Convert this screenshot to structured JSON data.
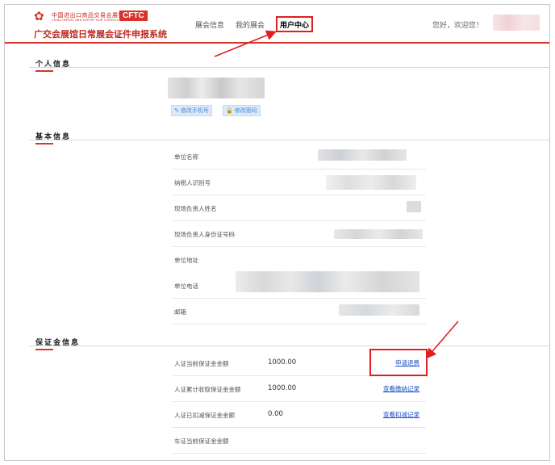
{
  "header": {
    "logo_cn": "中国进出口商品交易会展馆",
    "logo_en": "CHINA IMPORT AND EXPORT FAIR COMPLEX",
    "logo_badge": "CFTC",
    "title": "广交会展馆日常展会证件申报系统",
    "nav": [
      "展会信息",
      "我的展会",
      "用户中心"
    ],
    "greeting": "您好，欢迎您！"
  },
  "personal": {
    "heading": "个人信息",
    "btn_phone": "修改手机号",
    "btn_password": "修改密码"
  },
  "basic": {
    "heading": "基本信息",
    "rows": [
      "单位名称",
      "纳税人识别号",
      "现场负责人姓名",
      "现场负责人身份证号码",
      "单位地址",
      "单位电话",
      "邮箱"
    ]
  },
  "deposit": {
    "heading": "保证金信息",
    "rows": [
      {
        "label": "人证当前保证金金额",
        "amount": "1000.00",
        "link": "申请退费"
      },
      {
        "label": "人证累计收取保证金金额",
        "amount": "1000.00",
        "link": "查看缴纳记录"
      },
      {
        "label": "人证已扣减保证金金额",
        "amount": "0.00",
        "link": "查看扣减记录"
      },
      {
        "label": "车证当前保证金金额",
        "amount": "",
        "link": ""
      }
    ]
  },
  "colors": {
    "brand_red": "#d9342b",
    "link_blue": "#1a4fc4",
    "annotation_red": "#e02020"
  }
}
